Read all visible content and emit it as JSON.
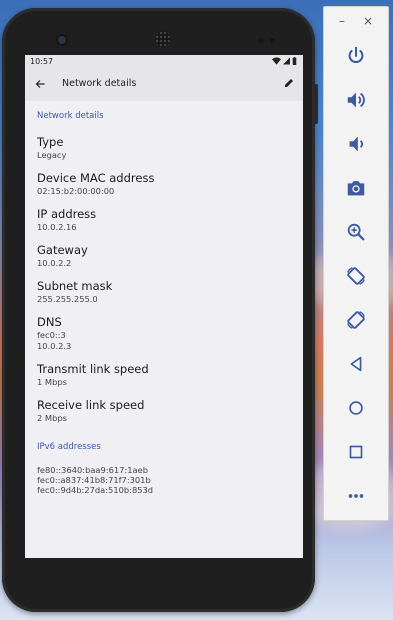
{
  "status_bar": {
    "time": "10:57"
  },
  "app_bar": {
    "title": "Network details"
  },
  "section_header": "Network details",
  "details": [
    {
      "title": "Type",
      "values": [
        "Legacy"
      ]
    },
    {
      "title": "Device MAC address",
      "values": [
        "02:15:b2:00:00:00"
      ]
    },
    {
      "title": "IP address",
      "values": [
        "10.0.2.16"
      ]
    },
    {
      "title": "Gateway",
      "values": [
        "10.0.2.2"
      ]
    },
    {
      "title": "Subnet mask",
      "values": [
        "255.255.255.0"
      ]
    },
    {
      "title": "DNS",
      "values": [
        "fec0::3",
        "10.0.2.3"
      ]
    },
    {
      "title": "Transmit link speed",
      "values": [
        "1 Mbps"
      ]
    },
    {
      "title": "Receive link speed",
      "values": [
        "2 Mbps"
      ]
    }
  ],
  "ipv6_header": "IPv6 addresses",
  "ipv6_addresses": [
    "fe80::3640:baa9:617:1aeb",
    "fec0::a837:41b8:71f7:301b",
    "fec0::9d4b:27da:510b:853d"
  ],
  "emulator_panel": {
    "minimize_label": "–",
    "close_label": "×",
    "tools": [
      "power-icon",
      "volume-up-icon",
      "volume-down-icon",
      "camera-icon",
      "zoom-icon",
      "rotate-left-icon",
      "rotate-right-icon",
      "back-icon",
      "home-icon",
      "overview-icon",
      "more-icon"
    ]
  },
  "colors": {
    "accent": "#3f5aa6",
    "icon": "#3d5a9e",
    "screen_bg": "#f0eff4"
  }
}
